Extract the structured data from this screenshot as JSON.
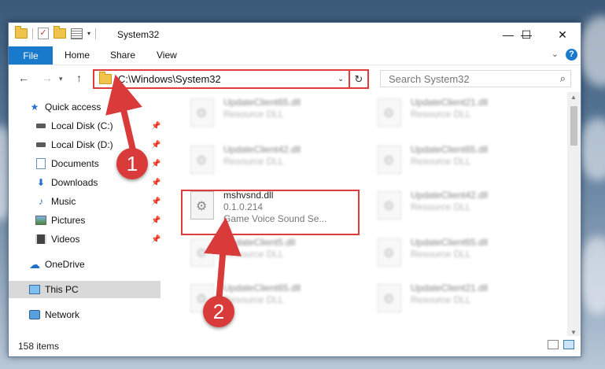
{
  "window": {
    "title": "System32",
    "controls": {
      "minimize": "—",
      "maximize": "☐",
      "close": "✕"
    }
  },
  "ribbon": {
    "tabs": [
      "File",
      "Home",
      "Share",
      "View"
    ],
    "help_label": "?"
  },
  "navigation": {
    "address": "C:\\Windows\\System32",
    "search_placeholder": "Search System32"
  },
  "sidebar": {
    "items": [
      {
        "label": "Quick access",
        "icon": "star-icon"
      },
      {
        "label": "Local Disk (C:)",
        "icon": "drive-icon",
        "pinned": true
      },
      {
        "label": "Local Disk (D:)",
        "icon": "drive-icon",
        "pinned": true
      },
      {
        "label": "Documents",
        "icon": "documents-icon",
        "pinned": true
      },
      {
        "label": "Downloads",
        "icon": "download-icon",
        "pinned": true
      },
      {
        "label": "Music",
        "icon": "music-icon",
        "pinned": true
      },
      {
        "label": "Pictures",
        "icon": "pictures-icon",
        "pinned": true
      },
      {
        "label": "Videos",
        "icon": "videos-icon",
        "pinned": true
      },
      {
        "label": "OneDrive",
        "icon": "cloud-icon"
      },
      {
        "label": "This PC",
        "icon": "computer-icon",
        "selected": true
      },
      {
        "label": "Network",
        "icon": "network-icon"
      }
    ]
  },
  "files": {
    "left_column": [
      {
        "name": "UpdateClient65.dll",
        "type": "Resource DLL"
      },
      {
        "name": "UpdateClient42.dll",
        "type": "Resource DLL"
      },
      {
        "name": "mshvsnd.dll",
        "version": "0.1.0.214",
        "description": "Game Voice Sound Se..."
      },
      {
        "name": "UpdateClient5.dll",
        "type": "Resource DLL"
      },
      {
        "name": "UpdateClient65.dll",
        "type": "Resource DLL"
      }
    ],
    "right_column": [
      {
        "name": "UpdateClient21.dll",
        "type": "Resource DLL"
      },
      {
        "name": "UpdateClient65.dll",
        "type": "Resource DLL"
      },
      {
        "name": "UpdateClient42.dll",
        "type": "Resource DLL"
      },
      {
        "name": "UpdateClient65.dll",
        "type": "Resource DLL"
      },
      {
        "name": "UpdateClient21.dll",
        "type": "Resource DLL"
      }
    ]
  },
  "status": {
    "item_count": "158 items"
  },
  "callouts": {
    "one": "1",
    "two": "2"
  },
  "colors": {
    "accent": "#1979ca",
    "highlight": "#e03c3c",
    "callout": "#d93b3b"
  }
}
